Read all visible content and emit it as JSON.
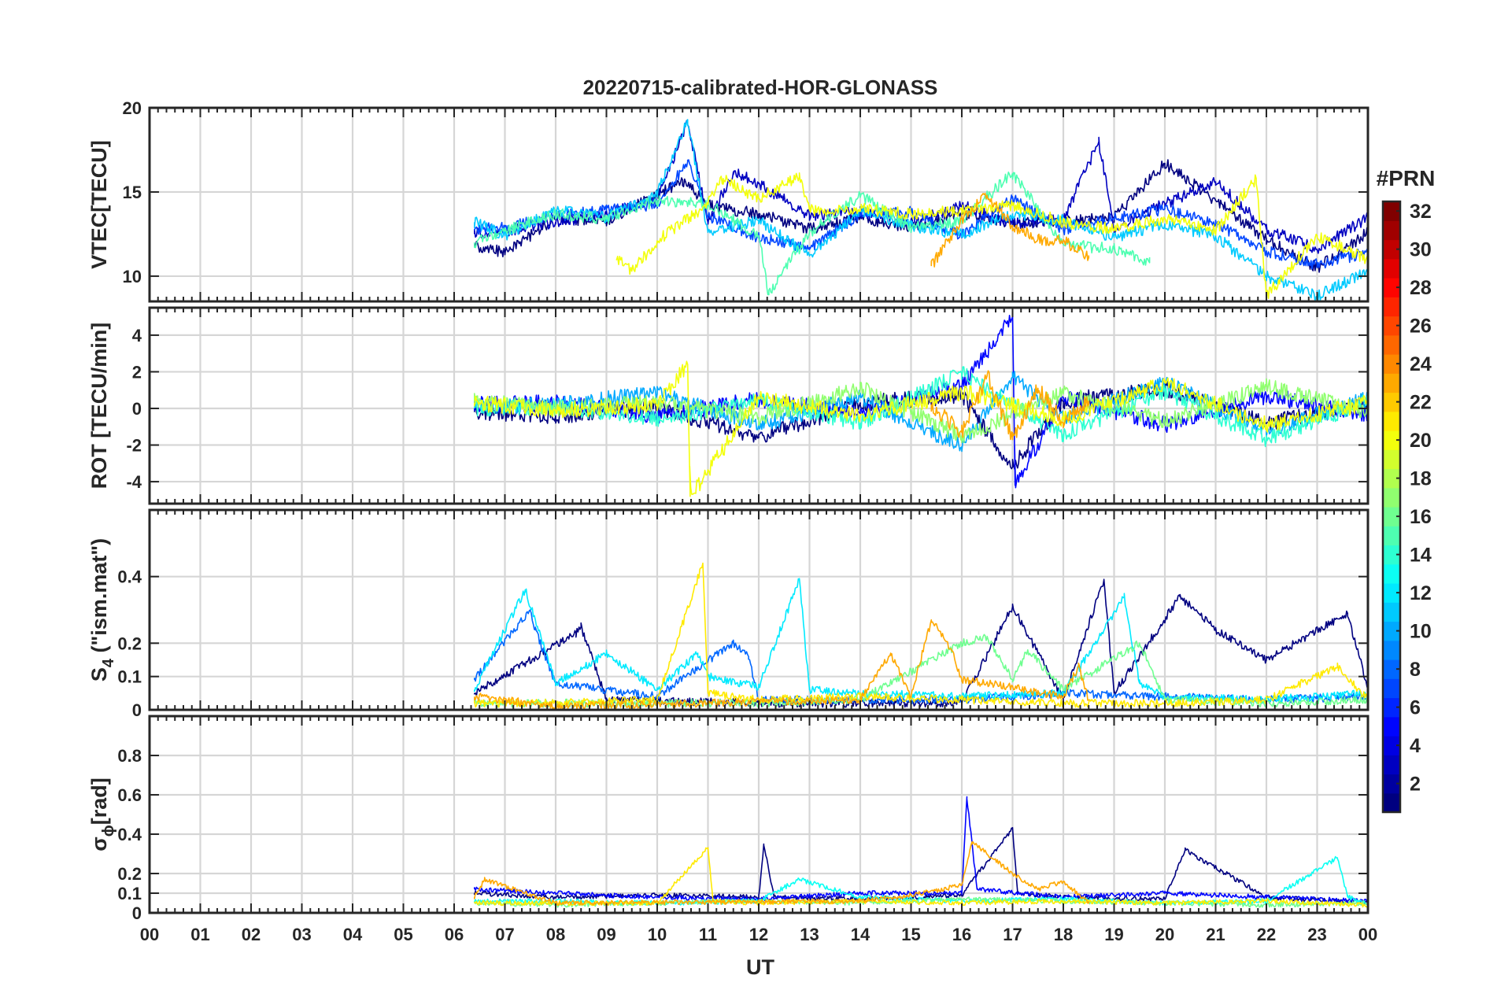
{
  "chart_data": {
    "type": "line",
    "title": "20220715-calibrated-HOR-GLONASS",
    "xlabel": "UT",
    "x_ticks": [
      "00",
      "01",
      "02",
      "03",
      "04",
      "05",
      "06",
      "07",
      "08",
      "09",
      "10",
      "11",
      "12",
      "13",
      "14",
      "15",
      "16",
      "17",
      "18",
      "19",
      "20",
      "21",
      "22",
      "23",
      "00"
    ],
    "xlim_hours": [
      0,
      24
    ],
    "data_start_hour": 6.4,
    "grid": true,
    "colorbar": {
      "title": "#PRN",
      "ticks": [
        "2",
        "4",
        "6",
        "8",
        "10",
        "12",
        "14",
        "16",
        "18",
        "20",
        "22",
        "24",
        "26",
        "28",
        "30",
        "32"
      ],
      "range": [
        1,
        32
      ],
      "colormap": "jet"
    },
    "panels": [
      {
        "ylabel_main": "VTEC[TECU]",
        "ylabel_sub": "",
        "ylim": [
          8.5,
          20
        ],
        "yticks": [
          "10",
          "15",
          "20"
        ],
        "ytick_values": [
          10,
          15,
          20
        ],
        "series": [
          {
            "prn": 1,
            "hours": [
              6.4,
              7.0,
              8.0,
              9.0,
              10.0,
              10.5,
              11.0,
              12.0,
              13.0,
              14.0,
              15.0,
              16.0,
              17.0,
              18.0,
              19.0,
              20.0,
              21.0,
              22.0,
              23.0,
              24.0
            ],
            "values": [
              11.8,
              11.4,
              13.4,
              13.3,
              14.8,
              15.7,
              14.2,
              13.7,
              12.8,
              13.5,
              12.9,
              13.7,
              13.2,
              13.2,
              13.5,
              16.7,
              14.5,
              12.2,
              10.5,
              12.6
            ]
          },
          {
            "prn": 3,
            "hours": [
              6.4,
              7.0,
              8.0,
              9.0,
              10.0,
              10.6,
              11.0,
              11.5,
              12.0,
              13.0,
              14.0,
              15.0,
              16.0,
              17.0,
              18.0,
              18.7,
              19.0,
              20.0,
              21.0,
              22.0,
              23.0,
              24.0
            ],
            "values": [
              12.5,
              12.7,
              13.2,
              13.7,
              14.5,
              19.2,
              13.2,
              16.2,
              15.5,
              13.6,
              13.8,
              13.2,
              14.2,
              13.1,
              13.4,
              18.0,
              12.8,
              14.3,
              15.6,
              12.8,
              11.6,
              13.5
            ]
          },
          {
            "prn": 7,
            "hours": [
              6.4,
              7.0,
              8.0,
              9.0,
              10.0,
              10.6,
              11.0,
              12.0,
              13.0,
              14.0,
              15.0,
              16.0,
              17.0,
              18.0,
              19.0,
              20.0,
              21.0,
              22.0,
              23.0,
              24.0
            ],
            "values": [
              12.8,
              12.9,
              13.6,
              13.9,
              14.3,
              16.8,
              13.6,
              12.3,
              11.7,
              13.7,
              13.8,
              12.4,
              14.6,
              12.8,
              13.4,
              14.0,
              13.1,
              11.5,
              10.7,
              11.4
            ]
          },
          {
            "prn": 11,
            "hours": [
              6.4,
              7.0,
              8.0,
              9.0,
              10.0,
              10.6,
              11.0,
              12.0,
              13.0,
              14.0,
              15.0,
              16.0,
              17.0,
              18.0,
              19.0,
              20.0,
              21.0,
              22.0,
              23.0,
              24.0
            ],
            "values": [
              13.2,
              12.4,
              13.9,
              13.5,
              14.9,
              19.3,
              12.6,
              13.3,
              11.2,
              13.9,
              13.0,
              12.5,
              13.7,
              13.3,
              12.3,
              13.1,
              12.4,
              10.0,
              8.8,
              10.3
            ]
          },
          {
            "prn": 15,
            "hours": [
              6.4,
              7.0,
              8.0,
              9.0,
              10.0,
              11.0,
              12.0,
              12.2,
              13.0,
              14.0,
              15.0,
              16.0,
              17.0,
              18.0,
              19.0,
              19.7
            ],
            "values": [
              12.0,
              12.7,
              13.7,
              13.4,
              14.5,
              14.3,
              12.4,
              8.9,
              12.6,
              14.8,
              12.9,
              13.3,
              16.1,
              11.9,
              11.6,
              10.8
            ]
          },
          {
            "prn": 20,
            "hours": [
              9.2,
              9.5,
              10.0,
              11.0,
              11.3,
              12.0,
              12.8,
              13.0,
              14.0,
              15.0,
              16.0,
              17.0,
              18.0,
              19.0,
              20.0,
              21.0,
              21.8,
              22.0,
              23.0,
              24.0
            ],
            "values": [
              11.0,
              10.3,
              12.1,
              14.3,
              15.8,
              14.6,
              15.9,
              13.9,
              14.0,
              13.7,
              13.9,
              14.2,
              13.2,
              12.8,
              13.4,
              12.7,
              15.8,
              8.8,
              12.4,
              11.0
            ]
          },
          {
            "prn": 23,
            "hours": [
              15.4,
              16.0,
              16.5,
              17.0,
              17.5,
              18.0,
              18.5
            ],
            "values": [
              10.6,
              13.4,
              14.8,
              13.0,
              12.2,
              12.1,
              11.1
            ]
          }
        ]
      },
      {
        "ylabel_main": "ROT [TECU/min]",
        "ylabel_sub": "",
        "ylim": [
          -5.2,
          5.5
        ],
        "yticks": [
          "-4",
          "-2",
          "0",
          "2",
          "4"
        ],
        "ytick_values": [
          -4,
          -2,
          0,
          2,
          4
        ],
        "series": [
          {
            "prn": 1,
            "hours": [
              6.4,
              8.0,
              10.0,
              12.0,
              14.0,
              16.0,
              17.0,
              18.0,
              20.0,
              22.0,
              24.0
            ],
            "values": [
              -0.2,
              -0.4,
              0.1,
              -1.6,
              0.3,
              0.7,
              -3.2,
              0.4,
              1.1,
              -0.8,
              0.2
            ]
          },
          {
            "prn": 5,
            "hours": [
              6.4,
              8.0,
              10.0,
              12.0,
              14.0,
              16.0,
              17.0,
              17.05,
              18.0,
              20.0,
              22.0,
              24.0
            ],
            "values": [
              0.2,
              0.3,
              -0.4,
              0.5,
              -0.3,
              1.2,
              5.0,
              -4.2,
              0.6,
              -0.9,
              0.7,
              -0.3
            ]
          },
          {
            "prn": 10,
            "hours": [
              6.4,
              8.0,
              10.0,
              12.0,
              14.0,
              16.0,
              17.0,
              18.0,
              20.0,
              22.0,
              24.0
            ],
            "values": [
              0.1,
              0.2,
              0.8,
              -0.9,
              0.6,
              -2.1,
              1.7,
              -0.6,
              1.4,
              -1.2,
              0.5
            ]
          },
          {
            "prn": 14,
            "hours": [
              6.4,
              8.0,
              10.0,
              12.0,
              14.0,
              16.0,
              18.0,
              20.0,
              22.0,
              24.0
            ],
            "values": [
              0.0,
              0.1,
              -0.6,
              0.4,
              -0.8,
              1.9,
              -1.4,
              0.9,
              -1.7,
              0.4
            ]
          },
          {
            "prn": 17,
            "hours": [
              6.4,
              8.0,
              10.0,
              12.0,
              14.0,
              16.0,
              18.0,
              20.0,
              22.0,
              24.0
            ],
            "values": [
              0.4,
              0.0,
              0.3,
              -0.5,
              1.1,
              -1.5,
              0.8,
              -0.7,
              1.2,
              -0.2
            ]
          },
          {
            "prn": 20,
            "hours": [
              6.4,
              8.0,
              10.0,
              10.6,
              10.65,
              12.0,
              14.0,
              16.0,
              18.0,
              20.0,
              22.0,
              24.0
            ],
            "values": [
              0.3,
              -0.1,
              0.2,
              2.4,
              -4.8,
              0.6,
              -0.4,
              0.9,
              -0.6,
              1.4,
              -0.9,
              0.3
            ]
          },
          {
            "prn": 23,
            "hours": [
              15.4,
              16.0,
              16.5,
              17.0,
              17.5,
              18.0,
              18.5
            ],
            "values": [
              0.2,
              -1.3,
              1.8,
              -1.7,
              1.1,
              -0.8,
              0.4
            ]
          }
        ]
      },
      {
        "ylabel_main": "S",
        "ylabel_sub": "4",
        "ylabel_rest": " (\"ism.mat\")",
        "ylim": [
          0,
          0.6
        ],
        "yticks": [
          "0",
          "0.1",
          "0.2",
          "0.4"
        ],
        "ytick_values": [
          0,
          0.1,
          0.2,
          0.4
        ],
        "series": [
          {
            "prn": 1,
            "hours": [
              6.4,
              8.4,
              8.5,
              9.0,
              12.0,
              16.0,
              17.0,
              18.0,
              18.8,
              19.0,
              20.3,
              21.0,
              22.0,
              23.6,
              24.0
            ],
            "values": [
              0.05,
              0.23,
              0.25,
              0.03,
              0.02,
              0.02,
              0.31,
              0.03,
              0.39,
              0.05,
              0.34,
              0.24,
              0.15,
              0.29,
              0.06
            ]
          },
          {
            "prn": 8,
            "hours": [
              6.4,
              7.5,
              7.6,
              8.0,
              10.0,
              11.5,
              11.8,
              12.0,
              14.0,
              16.0,
              18.0,
              20.0,
              22.0,
              24.0
            ],
            "values": [
              0.09,
              0.3,
              0.24,
              0.08,
              0.04,
              0.2,
              0.16,
              0.03,
              0.03,
              0.03,
              0.05,
              0.04,
              0.03,
              0.04
            ]
          },
          {
            "prn": 12,
            "hours": [
              6.4,
              7.4,
              8.0,
              9.0,
              10.0,
              10.8,
              11.0,
              12.0,
              12.8,
              13.0,
              14.0,
              16.0,
              18.0,
              19.2,
              19.5,
              20.0,
              22.0,
              24.0
            ],
            "values": [
              0.06,
              0.36,
              0.08,
              0.17,
              0.06,
              0.17,
              0.1,
              0.07,
              0.39,
              0.06,
              0.05,
              0.04,
              0.05,
              0.34,
              0.08,
              0.04,
              0.03,
              0.05
            ]
          },
          {
            "prn": 16,
            "hours": [
              6.4,
              8.0,
              10.0,
              12.0,
              14.0,
              16.0,
              16.5,
              17.0,
              17.3,
              18.0,
              19.5,
              20.0,
              22.0,
              24.0
            ],
            "values": [
              0.02,
              0.02,
              0.02,
              0.02,
              0.03,
              0.2,
              0.22,
              0.09,
              0.18,
              0.06,
              0.2,
              0.03,
              0.02,
              0.03
            ]
          },
          {
            "prn": 21,
            "hours": [
              6.4,
              8.0,
              10.0,
              10.9,
              11.0,
              12.0,
              14.0,
              16.0,
              18.0,
              20.0,
              22.0,
              23.4,
              24.0
            ],
            "values": [
              0.02,
              0.02,
              0.03,
              0.44,
              0.05,
              0.03,
              0.04,
              0.03,
              0.02,
              0.02,
              0.03,
              0.13,
              0.03
            ]
          },
          {
            "prn": 23,
            "hours": [
              6.4,
              8.0,
              14.0,
              14.6,
              15.0,
              15.4,
              15.8,
              16.0,
              17.0,
              17.5,
              18.0,
              18.3,
              18.5
            ],
            "values": [
              0.04,
              0.01,
              0.03,
              0.17,
              0.04,
              0.27,
              0.18,
              0.09,
              0.07,
              0.05,
              0.04,
              0.13,
              0.03
            ]
          }
        ]
      },
      {
        "ylabel_main": "σ",
        "ylabel_sub": "ϕ",
        "ylabel_rest": "[rad]",
        "ylim": [
          0,
          1
        ],
        "yticks": [
          "0",
          "0.1",
          "0.2",
          "0.4",
          "0.6",
          "0.8"
        ],
        "ytick_values": [
          0,
          0.1,
          0.2,
          0.4,
          0.6,
          0.8
        ],
        "series": [
          {
            "prn": 1,
            "hours": [
              6.4,
              8.0,
              10.0,
              12.0,
              12.1,
              12.3,
              14.0,
              16.0,
              17.0,
              17.1,
              18.0,
              20.0,
              20.4,
              22.0,
              24.0
            ],
            "values": [
              0.1,
              0.08,
              0.09,
              0.08,
              0.35,
              0.08,
              0.07,
              0.09,
              0.43,
              0.1,
              0.08,
              0.07,
              0.32,
              0.08,
              0.05
            ]
          },
          {
            "prn": 5,
            "hours": [
              6.4,
              8.0,
              10.0,
              12.0,
              14.0,
              16.0,
              16.1,
              16.3,
              18.0,
              20.0,
              22.0,
              24.0
            ],
            "values": [
              0.12,
              0.1,
              0.08,
              0.07,
              0.1,
              0.1,
              0.59,
              0.12,
              0.08,
              0.1,
              0.08,
              0.06
            ]
          },
          {
            "prn": 13,
            "hours": [
              6.4,
              8.0,
              10.0,
              12.0,
              12.8,
              14.0,
              16.0,
              18.0,
              20.0,
              22.0,
              23.4,
              23.6,
              24.0
            ],
            "values": [
              0.06,
              0.06,
              0.05,
              0.06,
              0.17,
              0.08,
              0.06,
              0.07,
              0.05,
              0.06,
              0.28,
              0.08,
              0.05
            ]
          },
          {
            "prn": 16,
            "hours": [
              6.4,
              8.0,
              10.0,
              12.0,
              14.0,
              16.0,
              18.0,
              20.0,
              22.0,
              24.0
            ],
            "values": [
              0.05,
              0.04,
              0.05,
              0.06,
              0.05,
              0.07,
              0.06,
              0.05,
              0.04,
              0.05
            ]
          },
          {
            "prn": 21,
            "hours": [
              6.4,
              8.0,
              10.0,
              11.0,
              11.1,
              12.0,
              14.0,
              16.0,
              18.0,
              20.0,
              22.0,
              24.0
            ],
            "values": [
              0.05,
              0.05,
              0.05,
              0.33,
              0.06,
              0.05,
              0.06,
              0.05,
              0.06,
              0.05,
              0.06,
              0.04
            ]
          },
          {
            "prn": 23,
            "hours": [
              6.4,
              6.6,
              8.0,
              14.0,
              15.0,
              16.0,
              16.2,
              17.0,
              17.5,
              18.0,
              18.5
            ],
            "values": [
              0.08,
              0.17,
              0.05,
              0.06,
              0.09,
              0.14,
              0.36,
              0.2,
              0.12,
              0.16,
              0.05
            ]
          }
        ]
      }
    ]
  }
}
